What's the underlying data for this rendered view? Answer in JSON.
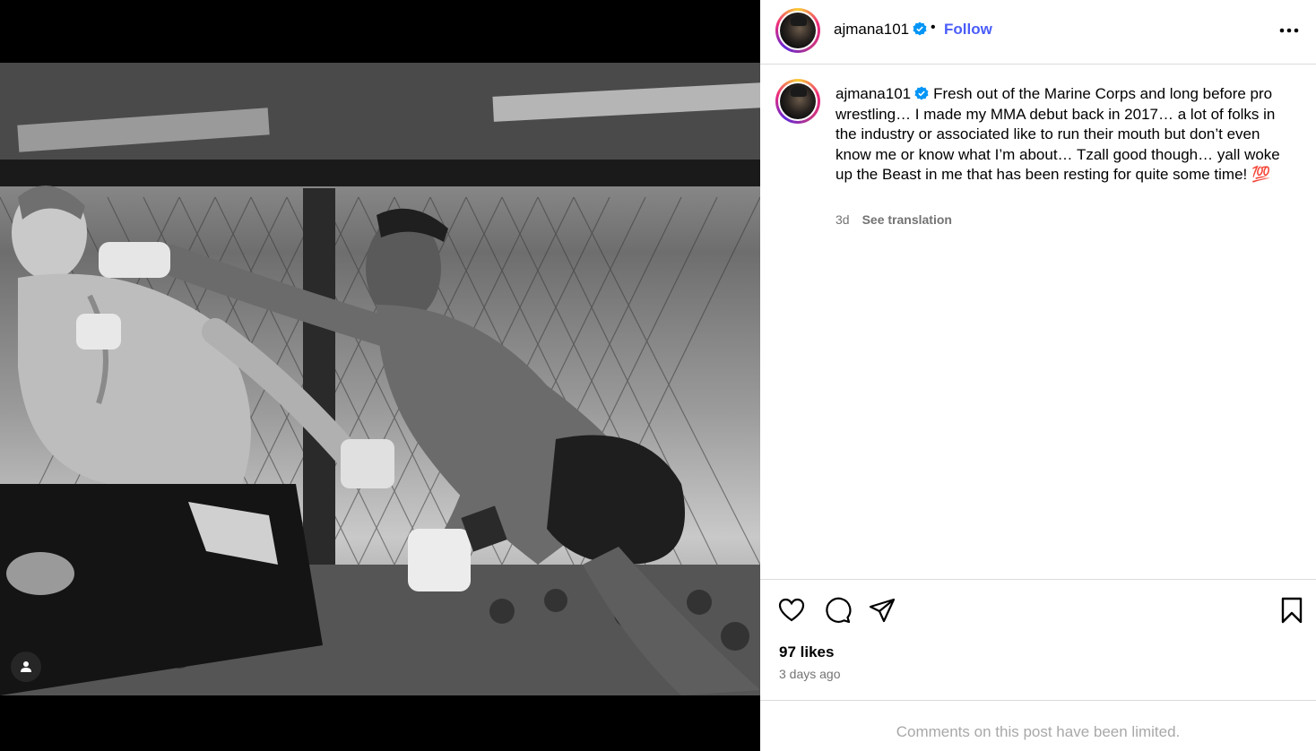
{
  "header": {
    "username": "ajmana101",
    "separator": "•",
    "follow_label": "Follow"
  },
  "caption": {
    "username": "ajmana101",
    "text": "Fresh out of the Marine Corps and long before pro wrestling… I made my MMA debut back in 2017… a lot of folks in the industry or associated like to run their mouth but don’t even know me or know what I’m about… Tzall good though… yall woke up the Beast in me that has been resting for quite some time! 💯",
    "time": "3d",
    "see_translation": "See translation"
  },
  "engagement": {
    "likes": "97 likes",
    "posted": "3 days ago"
  },
  "comments_notice": "Comments on this post have been limited.",
  "icons": {
    "verified": "verified-badge-icon",
    "more": "more-options-icon",
    "like": "heart-icon",
    "comment": "comment-icon",
    "share": "share-icon",
    "save": "bookmark-icon",
    "tags": "user-tag-icon"
  },
  "colors": {
    "accent": "#4a5df9",
    "verified": "#0095f6",
    "secondary_text": "#737373",
    "border": "#dbdbdb"
  }
}
